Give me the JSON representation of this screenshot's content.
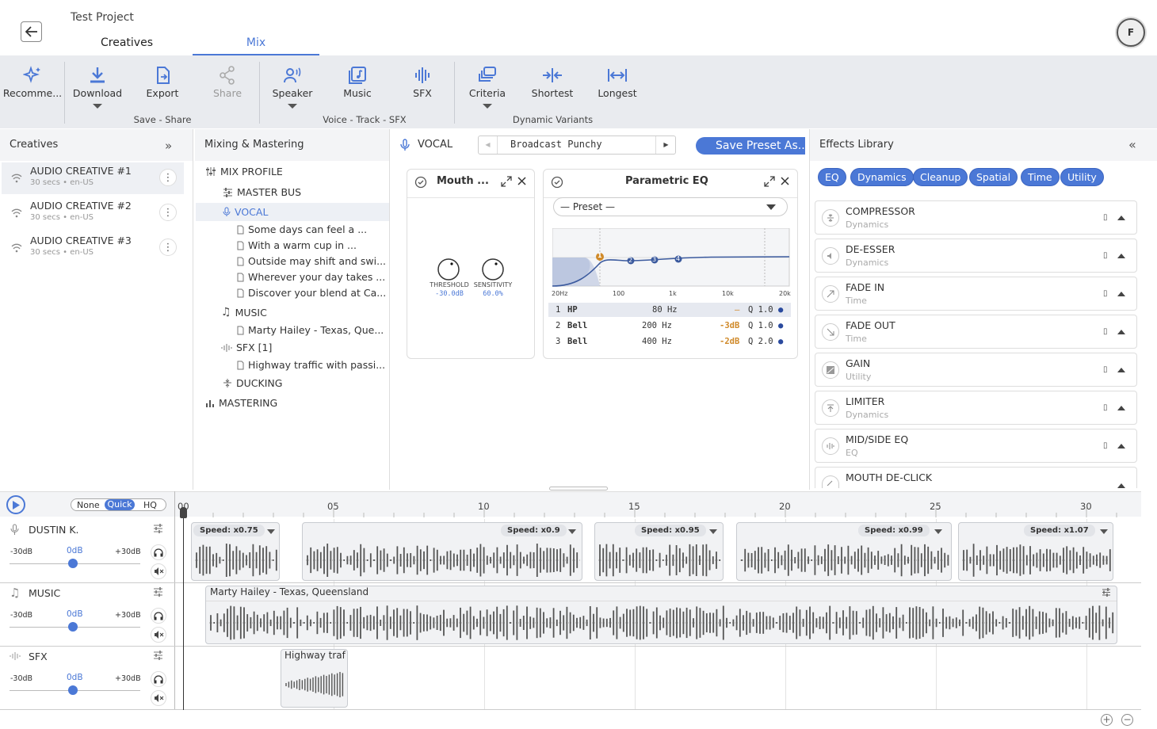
{
  "header": {
    "project_title": "Test Project",
    "tabs": [
      "Creatives",
      "Mix"
    ],
    "active_tab": "Mix",
    "avatar_initial": "F"
  },
  "toolbar": {
    "items": [
      {
        "label": "Recomme...",
        "icon": "sparkles-icon"
      },
      {
        "label": "Download",
        "icon": "download-icon",
        "has_menu": true
      },
      {
        "label": "Export",
        "icon": "export-icon"
      },
      {
        "label": "Share",
        "icon": "share-icon",
        "disabled": true
      },
      {
        "label": "Speaker",
        "icon": "speaker-icon",
        "has_menu": true
      },
      {
        "label": "Music",
        "icon": "music-icon"
      },
      {
        "label": "SFX",
        "icon": "waveform-icon"
      },
      {
        "label": "Criteria",
        "icon": "criteria-icon",
        "has_menu": true
      },
      {
        "label": "Shortest",
        "icon": "shortest-icon"
      },
      {
        "label": "Longest",
        "icon": "longest-icon"
      }
    ],
    "groups": [
      "Save - Share",
      "Voice - Track - SFX",
      "Dynamic Variants"
    ]
  },
  "creatives_panel": {
    "title": "Creatives",
    "items": [
      {
        "name": "AUDIO CREATIVE #1",
        "meta": "30 secs • en-US",
        "selected": true
      },
      {
        "name": "AUDIO CREATIVE #2",
        "meta": "30 secs • en-US"
      },
      {
        "name": "AUDIO CREATIVE #3",
        "meta": "30 secs • en-US"
      }
    ]
  },
  "mixing_panel": {
    "title": "Mixing & Mastering",
    "tree": {
      "profile": "MIX PROFILE",
      "master_bus": "MASTER BUS",
      "vocal": "VOCAL",
      "vocal_items": [
        "Some days can feel a ...",
        "With a warm cup in ...",
        "Outside may shift and swi...",
        "Wherever your day takes ...",
        "Discover your blend at Ca..."
      ],
      "music": "MUSIC",
      "music_items": [
        "Marty Hailey - Texas, Que..."
      ],
      "sfx": "SFX [1]",
      "sfx_items": [
        "Highway traffic with passi..."
      ],
      "ducking": "DUCKING",
      "mastering": "MASTERING"
    }
  },
  "center": {
    "track_label": "VOCAL",
    "preset_name": "Broadcast Punchy",
    "save_preset_label": "Save Preset As..",
    "mouth_card": {
      "title": "Mouth ...",
      "knobs": [
        {
          "label": "THRESHOLD",
          "value": "-30.0dB"
        },
        {
          "label": "SENSITIVITY",
          "value": "60.0%"
        }
      ]
    },
    "eq_card": {
      "title": "Parametric EQ",
      "preset_placeholder": "— Preset —",
      "freq_labels": [
        "20Hz",
        "100",
        "1k",
        "10k",
        "20k"
      ],
      "bands": [
        {
          "num": "1",
          "type": "HP",
          "freq": "80 Hz",
          "gain": "–",
          "q": "Q 1.0"
        },
        {
          "num": "2",
          "type": "Bell",
          "freq": "200 Hz",
          "gain": "-3dB",
          "q": "Q 1.0"
        },
        {
          "num": "3",
          "type": "Bell",
          "freq": "400 Hz",
          "gain": "-2dB",
          "q": "Q 2.0"
        }
      ],
      "curve_nodes": [
        "1",
        "2",
        "3",
        "4"
      ]
    }
  },
  "effects_panel": {
    "title": "Effects Library",
    "chips": [
      "EQ",
      "Dynamics",
      "Cleanup",
      "Spatial",
      "Time",
      "Utility"
    ],
    "items": [
      {
        "name": "COMPRESSOR",
        "cat": "Dynamics",
        "icon": "compressor-icon"
      },
      {
        "name": "DE-ESSER",
        "cat": "Dynamics",
        "icon": "de-esser-icon"
      },
      {
        "name": "FADE IN",
        "cat": "Time",
        "icon": "fade-in-icon"
      },
      {
        "name": "FADE OUT",
        "cat": "Time",
        "icon": "fade-out-icon"
      },
      {
        "name": "GAIN",
        "cat": "Utility",
        "icon": "gain-icon"
      },
      {
        "name": "LIMITER",
        "cat": "Dynamics",
        "icon": "limiter-icon"
      },
      {
        "name": "MID/SIDE EQ",
        "cat": "EQ",
        "icon": "mid-side-icon"
      },
      {
        "name": "MOUTH DE-CLICK",
        "cat": "",
        "icon": "de-click-icon"
      }
    ]
  },
  "timeline": {
    "quality_options": [
      "None",
      "Quick",
      "HQ"
    ],
    "selected_quality": "Quick",
    "ticks": [
      "00",
      "05",
      "10",
      "15",
      "20",
      "25",
      "30"
    ],
    "tracks": [
      {
        "name": "DUSTIN K.",
        "min": "-30dB",
        "val": "0dB",
        "max": "+30dB"
      },
      {
        "name": "MUSIC",
        "min": "-30dB",
        "val": "0dB",
        "max": "+30dB"
      },
      {
        "name": "SFX",
        "min": "-30dB",
        "val": "0dB",
        "max": "+30dB"
      }
    ],
    "vocal_clips": [
      "Speed: x0.75",
      "Speed: x0.9",
      "Speed: x0.95",
      "Speed: x0.99",
      "Speed: x1.07"
    ],
    "music_clip": "Marty Hailey - Texas, Queensland",
    "sfx_clip": "Highway traf"
  },
  "colors": {
    "accent": "#4b78d6",
    "toolbar_bg": "#e9ebef",
    "eq_node": "#d08a2a"
  }
}
